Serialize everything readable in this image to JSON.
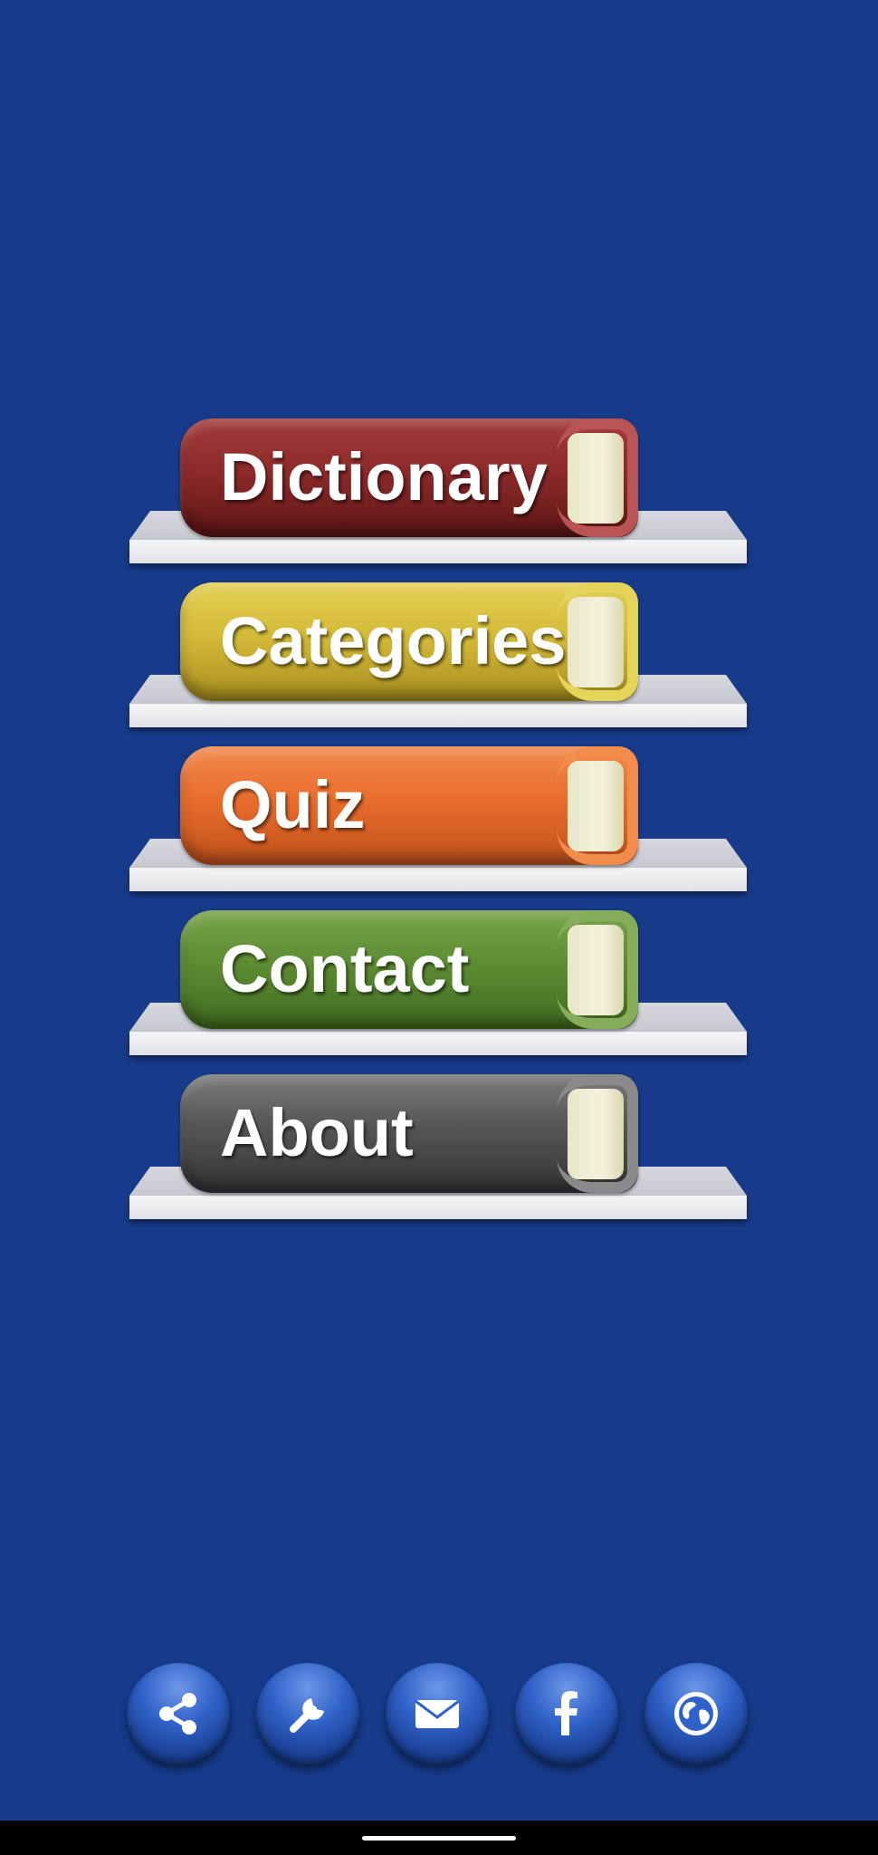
{
  "menu": {
    "items": [
      {
        "label": "Dictionary",
        "color": "#8e2a2a",
        "accent": "#b85454",
        "icon": "red-book"
      },
      {
        "label": "Categories",
        "color": "#d4bb3a",
        "accent": "#e6d45a",
        "icon": "yellow-book"
      },
      {
        "label": "Quiz",
        "color": "#e96d2c",
        "accent": "#f18c4c",
        "icon": "orange-book"
      },
      {
        "label": "Contact",
        "color": "#5e8c33",
        "accent": "#86ad5a",
        "icon": "green-book"
      },
      {
        "label": "About",
        "color": "#555555",
        "accent": "#8a8a8a",
        "icon": "gray-book"
      }
    ]
  },
  "toolbar": {
    "buttons": [
      {
        "icon": "share-icon"
      },
      {
        "icon": "wrench-icon"
      },
      {
        "icon": "mail-icon"
      },
      {
        "icon": "facebook-icon"
      },
      {
        "icon": "globe-icon"
      }
    ]
  },
  "colors": {
    "background": "#173a8a",
    "shelf": "#e8e9ed",
    "button": "#2f62c9"
  }
}
